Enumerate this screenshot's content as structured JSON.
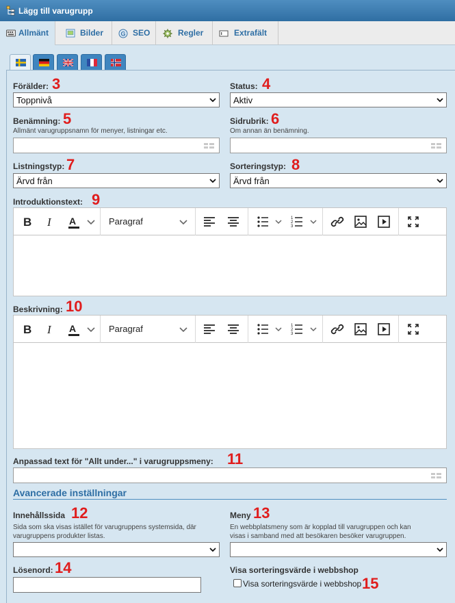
{
  "window": {
    "title": "Lägg till varugrupp"
  },
  "tabs": [
    {
      "label": "Allmänt",
      "icon": "keyboard-icon"
    },
    {
      "label": "Bilder",
      "icon": "image-icon"
    },
    {
      "label": "SEO",
      "icon": "seo-icon"
    },
    {
      "label": "Regler",
      "icon": "rules-icon"
    },
    {
      "label": "Extrafält",
      "icon": "extra-fields-icon"
    }
  ],
  "languages": [
    "swedish-flag",
    "german-flag",
    "uk-flag",
    "french-flag",
    "norwegian-flag"
  ],
  "form": {
    "parent": {
      "label": "Förälder:",
      "value": "Toppnivå",
      "marker": "3"
    },
    "status": {
      "label": "Status:",
      "value": "Aktiv",
      "marker": "4"
    },
    "name": {
      "label": "Benämning:",
      "help": "Allmänt varugruppsnamn för menyer, listningar etc.",
      "value": "",
      "marker": "5"
    },
    "subtitle": {
      "label": "Sidrubrik:",
      "help": "Om annan än benämning.",
      "value": "",
      "marker": "6"
    },
    "listing_type": {
      "label": "Listningstyp:",
      "value": "Ärvd från",
      "marker": "7"
    },
    "sort_type": {
      "label": "Sorteringstyp:",
      "value": "Ärvd från",
      "marker": "8"
    },
    "intro": {
      "label": "Introduktionstext:",
      "marker": "9",
      "paragraph": "Paragraf"
    },
    "description": {
      "label": "Beskrivning:",
      "marker": "10",
      "paragraph": "Paragraf"
    },
    "custom_text": {
      "label": "Anpassad text för \"Allt under...\" i varugruppsmeny:",
      "value": "",
      "marker": "11"
    },
    "advanced_heading": "Avancerade inställningar",
    "content_page": {
      "label": "Innehållssida",
      "help1": "Sida som ska visas istället för varugruppens systemsida, där",
      "help2": "varugruppens produkter listas.",
      "value": "",
      "marker": "12"
    },
    "menu": {
      "label": "Meny",
      "help1": "En webbplatsmeny som är kopplad till varugruppen och kan",
      "help2": "visas i samband med att besökaren besöker varugruppen.",
      "value": "",
      "marker": "13"
    },
    "password": {
      "label": "Lösenord:",
      "value": "",
      "marker": "14"
    },
    "show_sort": {
      "label": "Visa sorteringsvärde i webbshop",
      "checkbox_label": "Visa sorteringsvärde i webbshop",
      "checked": false,
      "marker": "15"
    }
  }
}
